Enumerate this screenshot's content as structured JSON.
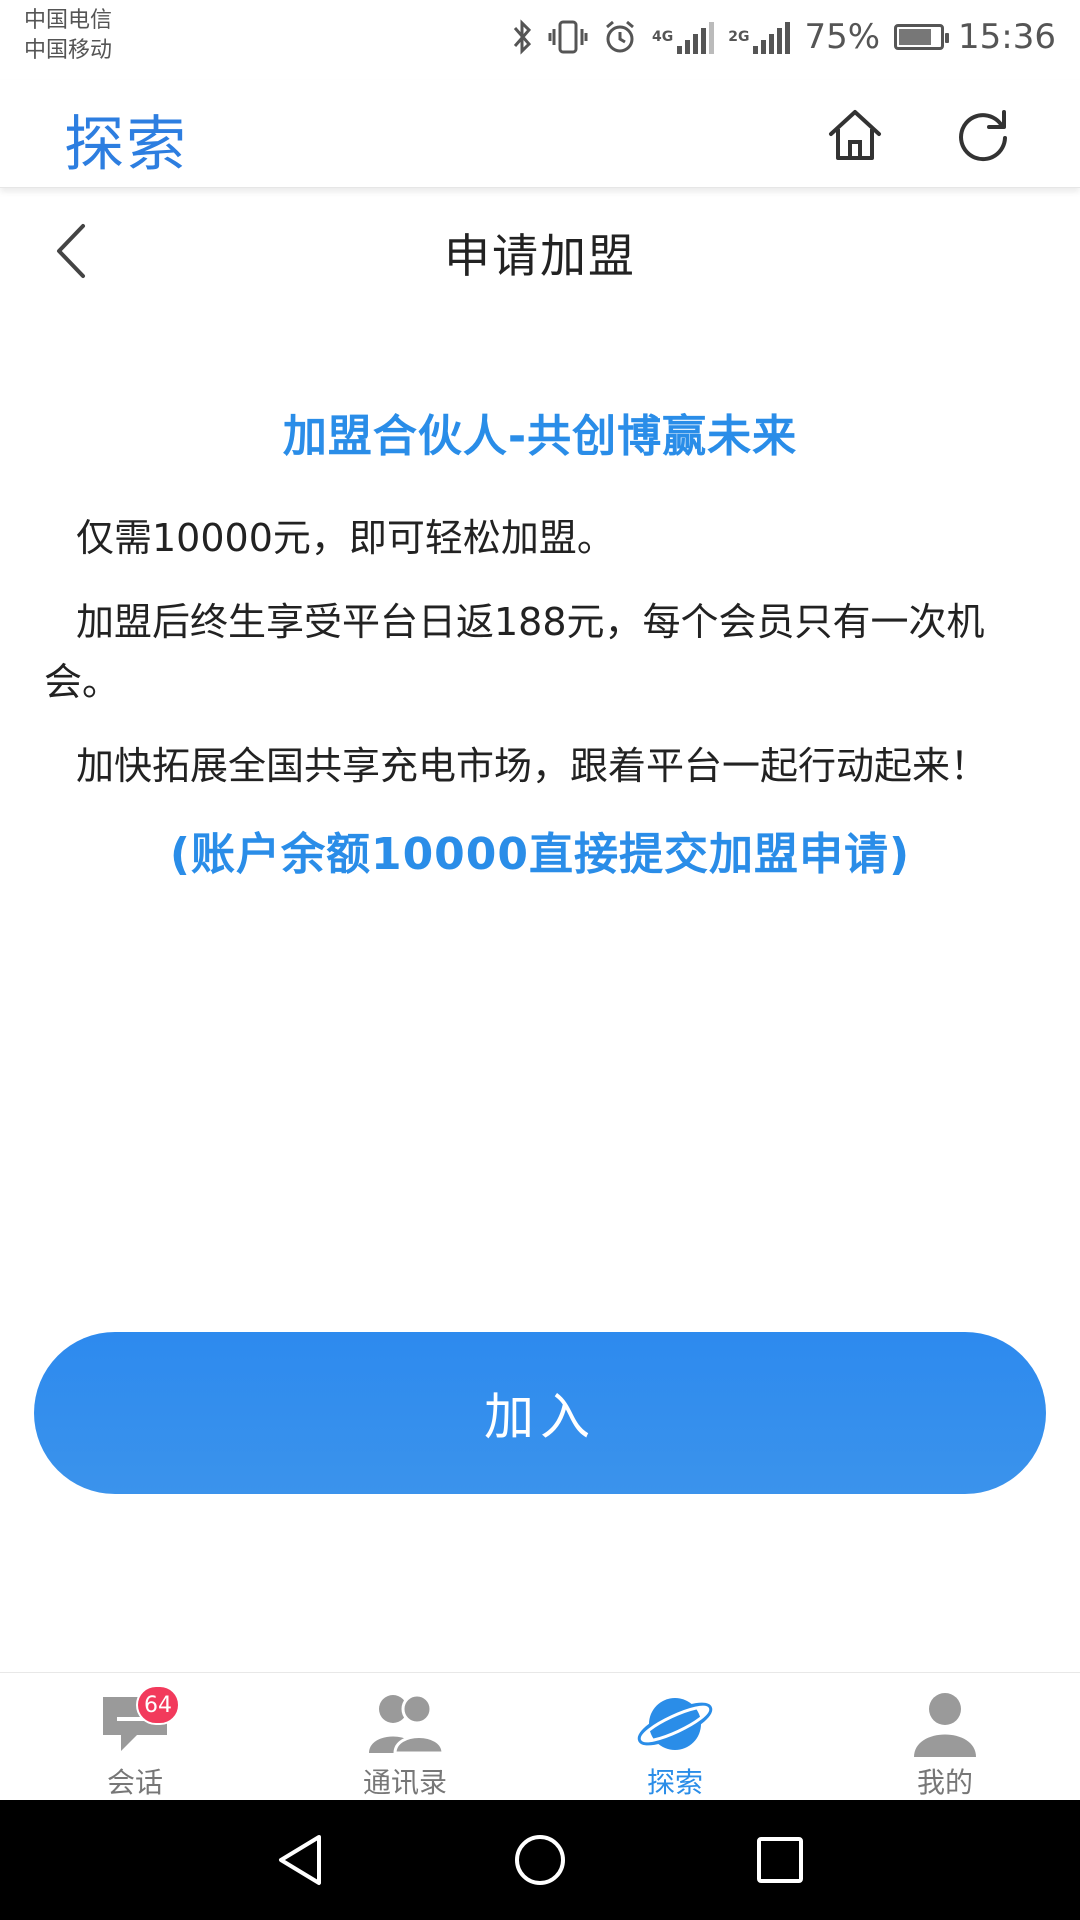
{
  "status_bar": {
    "carrier1": "中国电信",
    "carrier2": "中国移动",
    "net1": "4G",
    "net2": "2G",
    "battery": "75%",
    "time": "15:36"
  },
  "header": {
    "title": "探索"
  },
  "page": {
    "title": "申请加盟"
  },
  "content": {
    "heading": "加盟合伙人-共创博赢未来",
    "p1": "仅需10000元，即可轻松加盟。",
    "p2": "加盟后终生享受平台日返188元，每个会员只有一次机会。",
    "p3": "加快拓展全国共享充电市场，跟着平台一起行动起来！",
    "note": "(账户余额10000直接提交加盟申请)"
  },
  "join_button": {
    "label": "加入"
  },
  "tabs": [
    {
      "label": "会话",
      "badge": "64"
    },
    {
      "label": "通讯录"
    },
    {
      "label": "探索"
    },
    {
      "label": "我的"
    }
  ],
  "colors": {
    "accent": "#2a8de8",
    "badge": "#f23a5c",
    "tab_inactive": "#9a9a9a"
  }
}
